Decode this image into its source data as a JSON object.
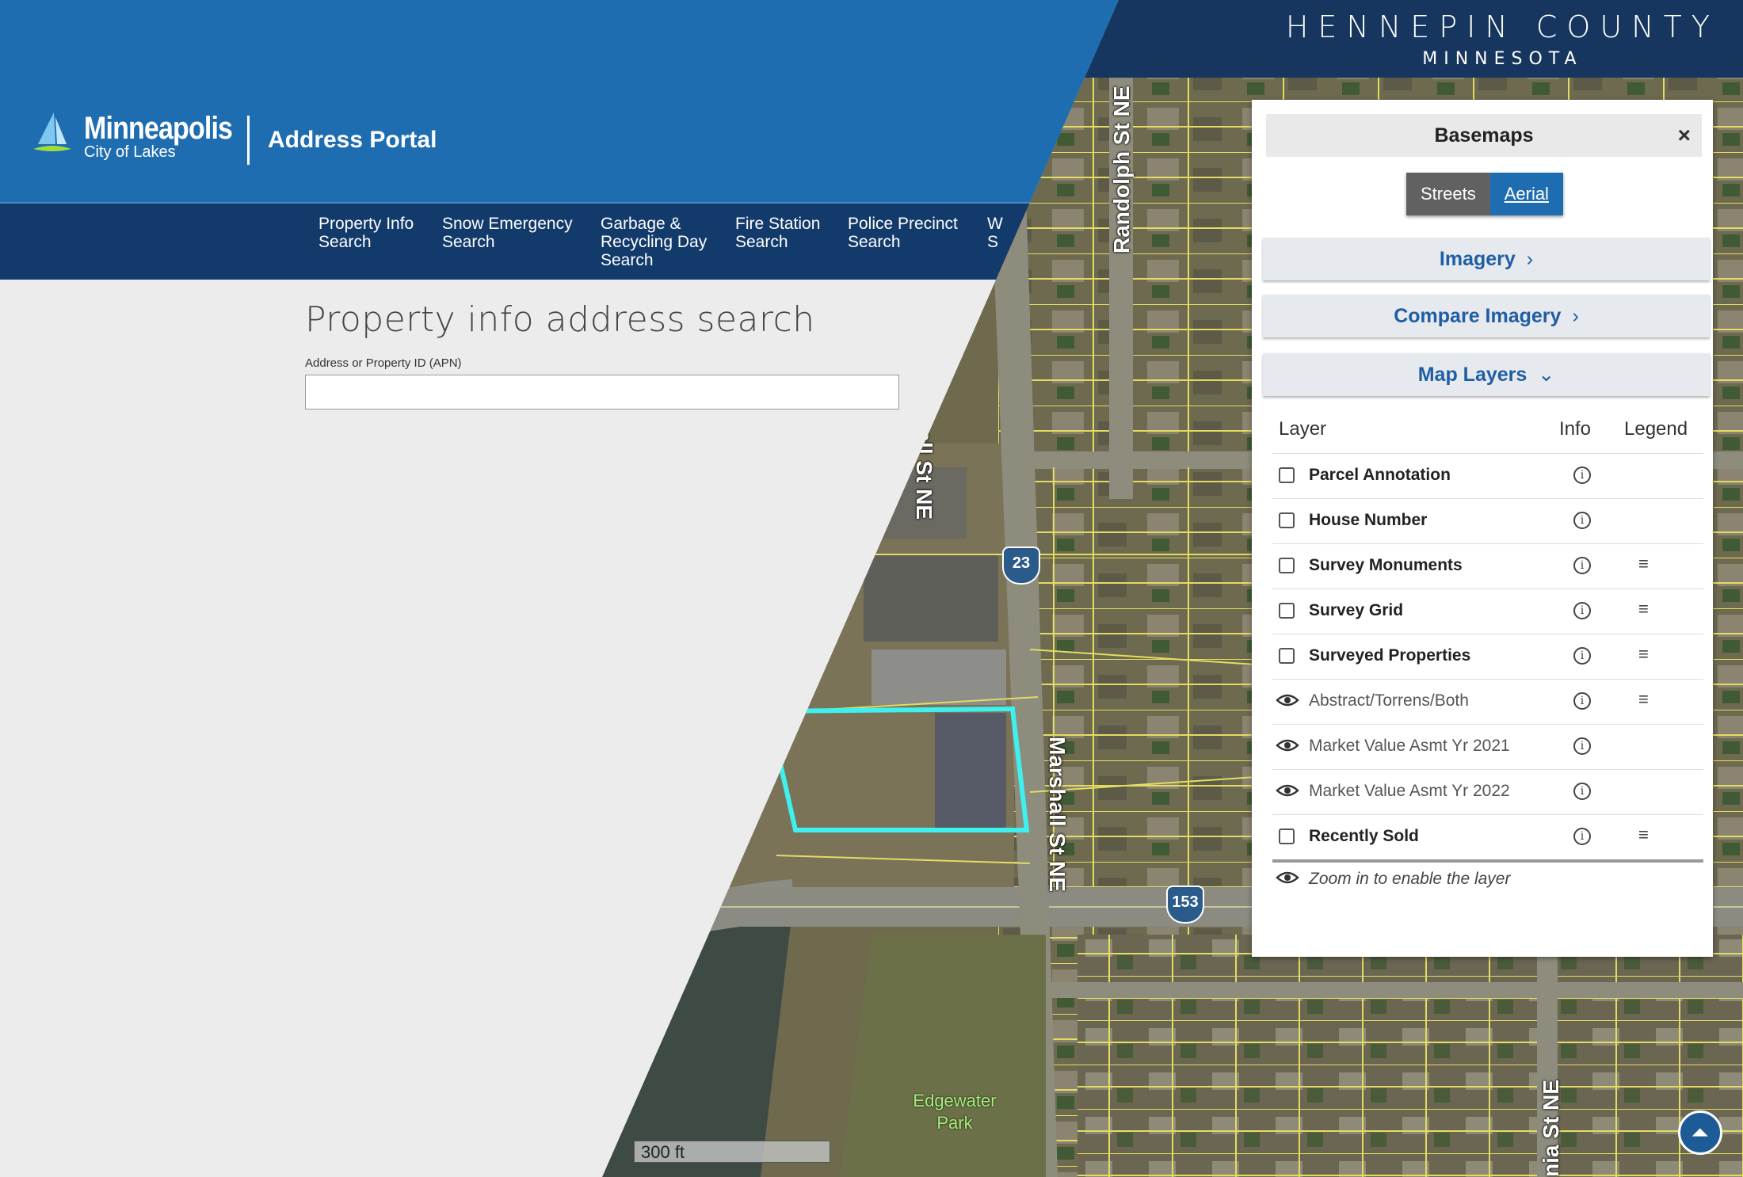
{
  "portal": {
    "logo_name": "Minneapolis",
    "logo_tagline": "City of Lakes",
    "name": "Address Portal",
    "nav": [
      "Property Info Search",
      "Snow Emergency Search",
      "Garbage & Recycling Day Search",
      "Fire Station Search",
      "Police Precinct Search",
      "W S"
    ],
    "page_title": "Property info address search",
    "search": {
      "label": "Address or Property ID (APN)",
      "value": "",
      "placeholder": ""
    }
  },
  "map": {
    "header_line1": "HENNEPIN COUNTY",
    "header_line2": "MINNESOTA",
    "streets": [
      "Marshall St NE",
      "Marshall St NE",
      "Randolph St NE",
      "nia St NE"
    ],
    "route_shields": [
      "23",
      "153"
    ],
    "park": "Edgewater Park",
    "scale": "300 ft",
    "colors": {
      "selection": "#3ef0ee",
      "parcel_lines": "#e8e26a",
      "header": "#16365f"
    }
  },
  "panel": {
    "title": "Basemaps",
    "close": "×",
    "basemap_options": [
      "Streets",
      "Aerial"
    ],
    "selected_basemap": "Aerial",
    "sections": [
      {
        "label": "Imagery",
        "chevron": "›"
      },
      {
        "label": "Compare Imagery",
        "chevron": "›"
      },
      {
        "label": "Map Layers",
        "chevron": "⌄"
      }
    ],
    "columns": [
      "Layer",
      "Info",
      "Legend"
    ],
    "layers": [
      {
        "name": "Parcel Annotation",
        "control": "checkbox",
        "legend": false
      },
      {
        "name": "House Number",
        "control": "checkbox",
        "legend": false
      },
      {
        "name": "Survey Monuments",
        "control": "checkbox",
        "legend": true
      },
      {
        "name": "Survey Grid",
        "control": "checkbox",
        "legend": true
      },
      {
        "name": "Surveyed Properties",
        "control": "checkbox",
        "legend": true
      },
      {
        "name": "Abstract/Torrens/Both",
        "control": "eye",
        "legend": true
      },
      {
        "name": "Market Value Asmt Yr 2021",
        "control": "eye",
        "legend": false
      },
      {
        "name": "Market Value Asmt Yr 2022",
        "control": "eye",
        "legend": false
      },
      {
        "name": "Recently Sold",
        "control": "checkbox",
        "legend": true
      }
    ],
    "zoom_note": "Zoom in to enable the layer"
  }
}
